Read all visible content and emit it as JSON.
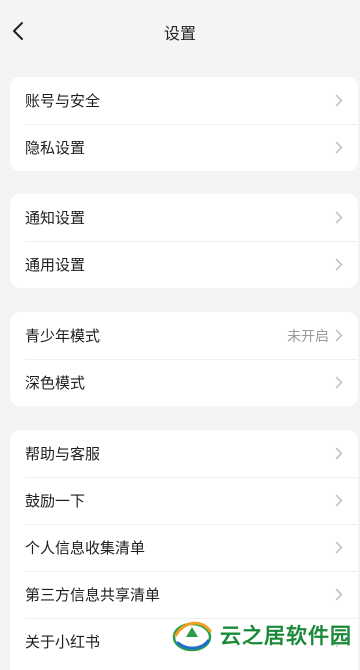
{
  "header": {
    "title": "设置",
    "back_icon": "chevron-left-icon"
  },
  "groups": [
    {
      "items": [
        {
          "label": "账号与安全",
          "icon": "chevron-right-icon"
        },
        {
          "label": "隐私设置",
          "icon": "chevron-right-icon"
        }
      ]
    },
    {
      "items": [
        {
          "label": "通知设置",
          "icon": "chevron-right-icon"
        },
        {
          "label": "通用设置",
          "icon": "chevron-right-icon"
        }
      ]
    },
    {
      "items": [
        {
          "label": "青少年模式",
          "value": "未开启",
          "icon": "chevron-right-icon"
        },
        {
          "label": "深色模式",
          "icon": "chevron-right-icon"
        }
      ]
    },
    {
      "items": [
        {
          "label": "帮助与客服",
          "icon": "chevron-right-icon"
        },
        {
          "label": "鼓励一下",
          "icon": "chevron-right-icon"
        },
        {
          "label": "个人信息收集清单",
          "icon": "chevron-right-icon"
        },
        {
          "label": "第三方信息共享清单",
          "icon": "chevron-right-icon"
        },
        {
          "label": "关于小红书",
          "icon": "chevron-right-icon"
        }
      ]
    }
  ],
  "watermark": {
    "text": "云之居软件园",
    "color": "#1a8a3a"
  },
  "colors": {
    "background": "#f4f4f5",
    "card": "#ffffff",
    "secondary_text": "#9a9a9a",
    "chevron": "#c4c4c4"
  }
}
